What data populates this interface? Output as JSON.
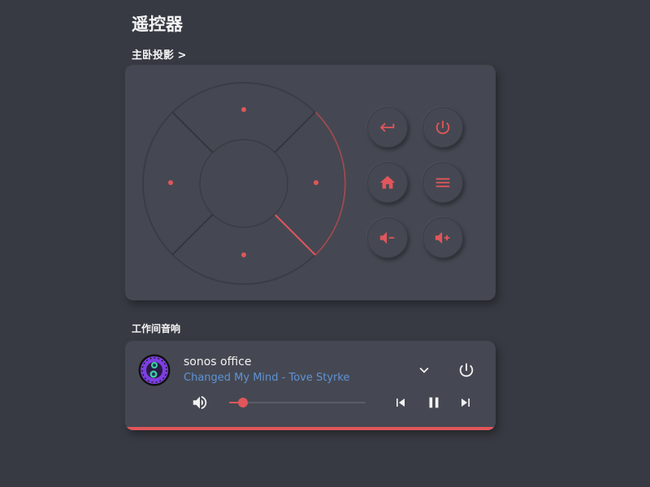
{
  "page": {
    "title": "遥控器"
  },
  "remote": {
    "section_title": "主卧投影 >",
    "buttons": [
      {
        "id": "back",
        "icon": "return-icon"
      },
      {
        "id": "power",
        "icon": "power-icon"
      },
      {
        "id": "home",
        "icon": "home-icon"
      },
      {
        "id": "menu",
        "icon": "menu-icon"
      },
      {
        "id": "volume_down",
        "icon": "volume-down-icon"
      },
      {
        "id": "volume_up",
        "icon": "volume-up-icon"
      }
    ],
    "dpad": [
      "up",
      "down",
      "left",
      "right",
      "center"
    ]
  },
  "media": {
    "section_title": "工作间音响",
    "player_name": "sonos office",
    "track": "Changed My Mind - Tove Styrke",
    "volume_level": 0.1,
    "progress": 1.0
  },
  "colors": {
    "background": "#373a42",
    "card": "#454852",
    "accent": "#e0565b",
    "link": "#5e93d6",
    "text": "#f2f2f2"
  }
}
